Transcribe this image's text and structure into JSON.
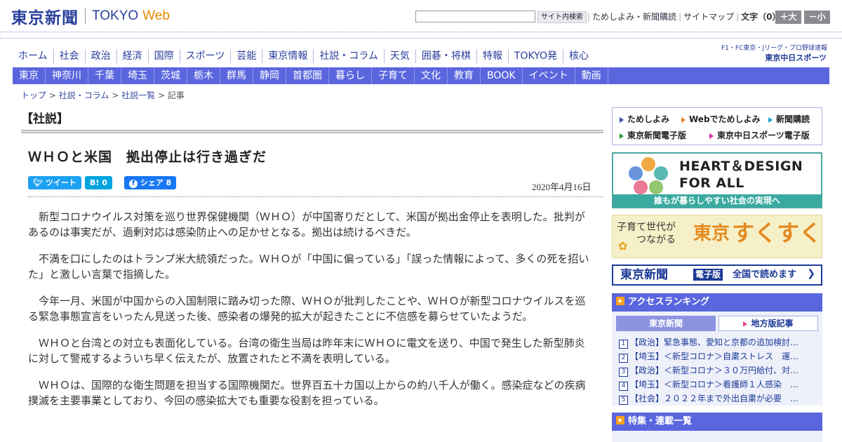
{
  "header": {
    "logo_jp": "東京新聞",
    "logo_en": "TOKYO",
    "logo_web": "Web",
    "search_placeholder": "",
    "search_button": "サイト内検索",
    "links": [
      "ためしよみ・新聞購読",
      "サイトマップ"
    ],
    "font_label": "文字（0）",
    "font_larger": "＋大",
    "font_smaller": "－小"
  },
  "nav_main": [
    "ホーム",
    "社会",
    "政治",
    "経済",
    "国際",
    "スポーツ",
    "芸能",
    "東京情報",
    "社説・コラム",
    "天気",
    "囲碁・将棋",
    "特報",
    "TOKYO発",
    "核心"
  ],
  "chunichi": {
    "line1": "F1・FC東京・Jリーグ・プロ野球速報",
    "line2": "東京中日スポーツ"
  },
  "nav_region": [
    "東京",
    "神奈川",
    "千葉",
    "埼玉",
    "茨城",
    "栃木",
    "群馬",
    "静岡",
    "首都圏",
    "暮らし",
    "子育て",
    "文化",
    "教育",
    "BOOK",
    "イベント",
    "動画"
  ],
  "breadcrumb": {
    "items": [
      "トップ",
      "社説・コラム",
      "社説一覧"
    ],
    "current": "記事",
    "separator": ">"
  },
  "article": {
    "section": "【社説】",
    "title": "ＷＨＯと米国　拠出停止は行き過ぎだ",
    "tweet": "ツイート",
    "hatena": "B! 0",
    "share": "シェア 8",
    "date": "2020年4月16日",
    "paragraphs": [
      "新型コロナウイルス対策を巡り世界保健機関（ＷＨＯ）が中国寄りだとして、米国が拠出金停止を表明した。批判があるのは事実だが、過剰対応は感染防止への足かせとなる。拠出は続けるべきだ。",
      "不満を口にしたのはトランプ米大統領だった。ＷＨＯが「中国に偏っている」「誤った情報によって、多くの死を招いた」と激しい言葉で指摘した。",
      "今年一月、米国が中国からの入国制限に踏み切った際、ＷＨＯが批判したことや、ＷＨＯが新型コロナウイルスを巡る緊急事態宣言をいったん見送った後、感染者の爆発的拡大が起きたことに不信感を募らせていたようだ。",
      "ＷＨＯと台湾との対立も表面化している。台湾の衛生当局は昨年末にＷＨＯに電文を送り、中国で発生した新型肺炎に対して警戒するよういち早く伝えたが、放置されたと不満を表明している。",
      "ＷＨＯは、国際的な衛生問題を担当する国際機関だ。世界百五十カ国以上からの約八千人が働く。感染症などの疾病撲滅を主要事業としており、今回の感染拡大でも重要な役割を担っている。"
    ]
  },
  "sidebar": {
    "links_row1": [
      "ためしよみ",
      "Webでためしよみ",
      "新聞購読"
    ],
    "links_row2": [
      "東京新聞電子版",
      "東京中日スポーツ電子版"
    ],
    "heart_title1": "HEART＆DESIGN",
    "heart_title2": "FOR ALL",
    "heart_footer": "誰もが暮らしやすい社会の実現へ",
    "sukusuku_line1": "子育て世代が",
    "sukusuku_line2": "つながる",
    "sukusuku_tokyo": "東京",
    "sukusuku_name": "すくすく",
    "digital_logo": "東京新聞",
    "digital_badge": "電子版",
    "digital_text": "全国で読めます",
    "digital_arrow": "❯",
    "ranking_title": "アクセスランキング",
    "tab_tokyo": "東京新聞",
    "tab_local": "地方版記事",
    "ranking": [
      {
        "n": "1",
        "text": "【政治】緊急事態、愛知と京都の追加検討…"
      },
      {
        "n": "2",
        "text": "【埼玉】＜新型コロナ＞自粛ストレス　運…"
      },
      {
        "n": "3",
        "text": "【政治】＜新型コロナ＞３０万円給付、対…"
      },
      {
        "n": "4",
        "text": "【埼玉】＜新型コロナ＞看護師１人感染　…"
      },
      {
        "n": "5",
        "text": "【社会】２０２２年まで外出自粛が必要　…"
      }
    ],
    "feature_title": "特集・連載一覧"
  },
  "colors": {
    "brand": "#2a3f9a",
    "nav_bg": "#5a66de",
    "accent_orange": "#e68a00",
    "twitter": "#1da1f2",
    "hatena": "#00a4de",
    "facebook": "#1877f2"
  }
}
